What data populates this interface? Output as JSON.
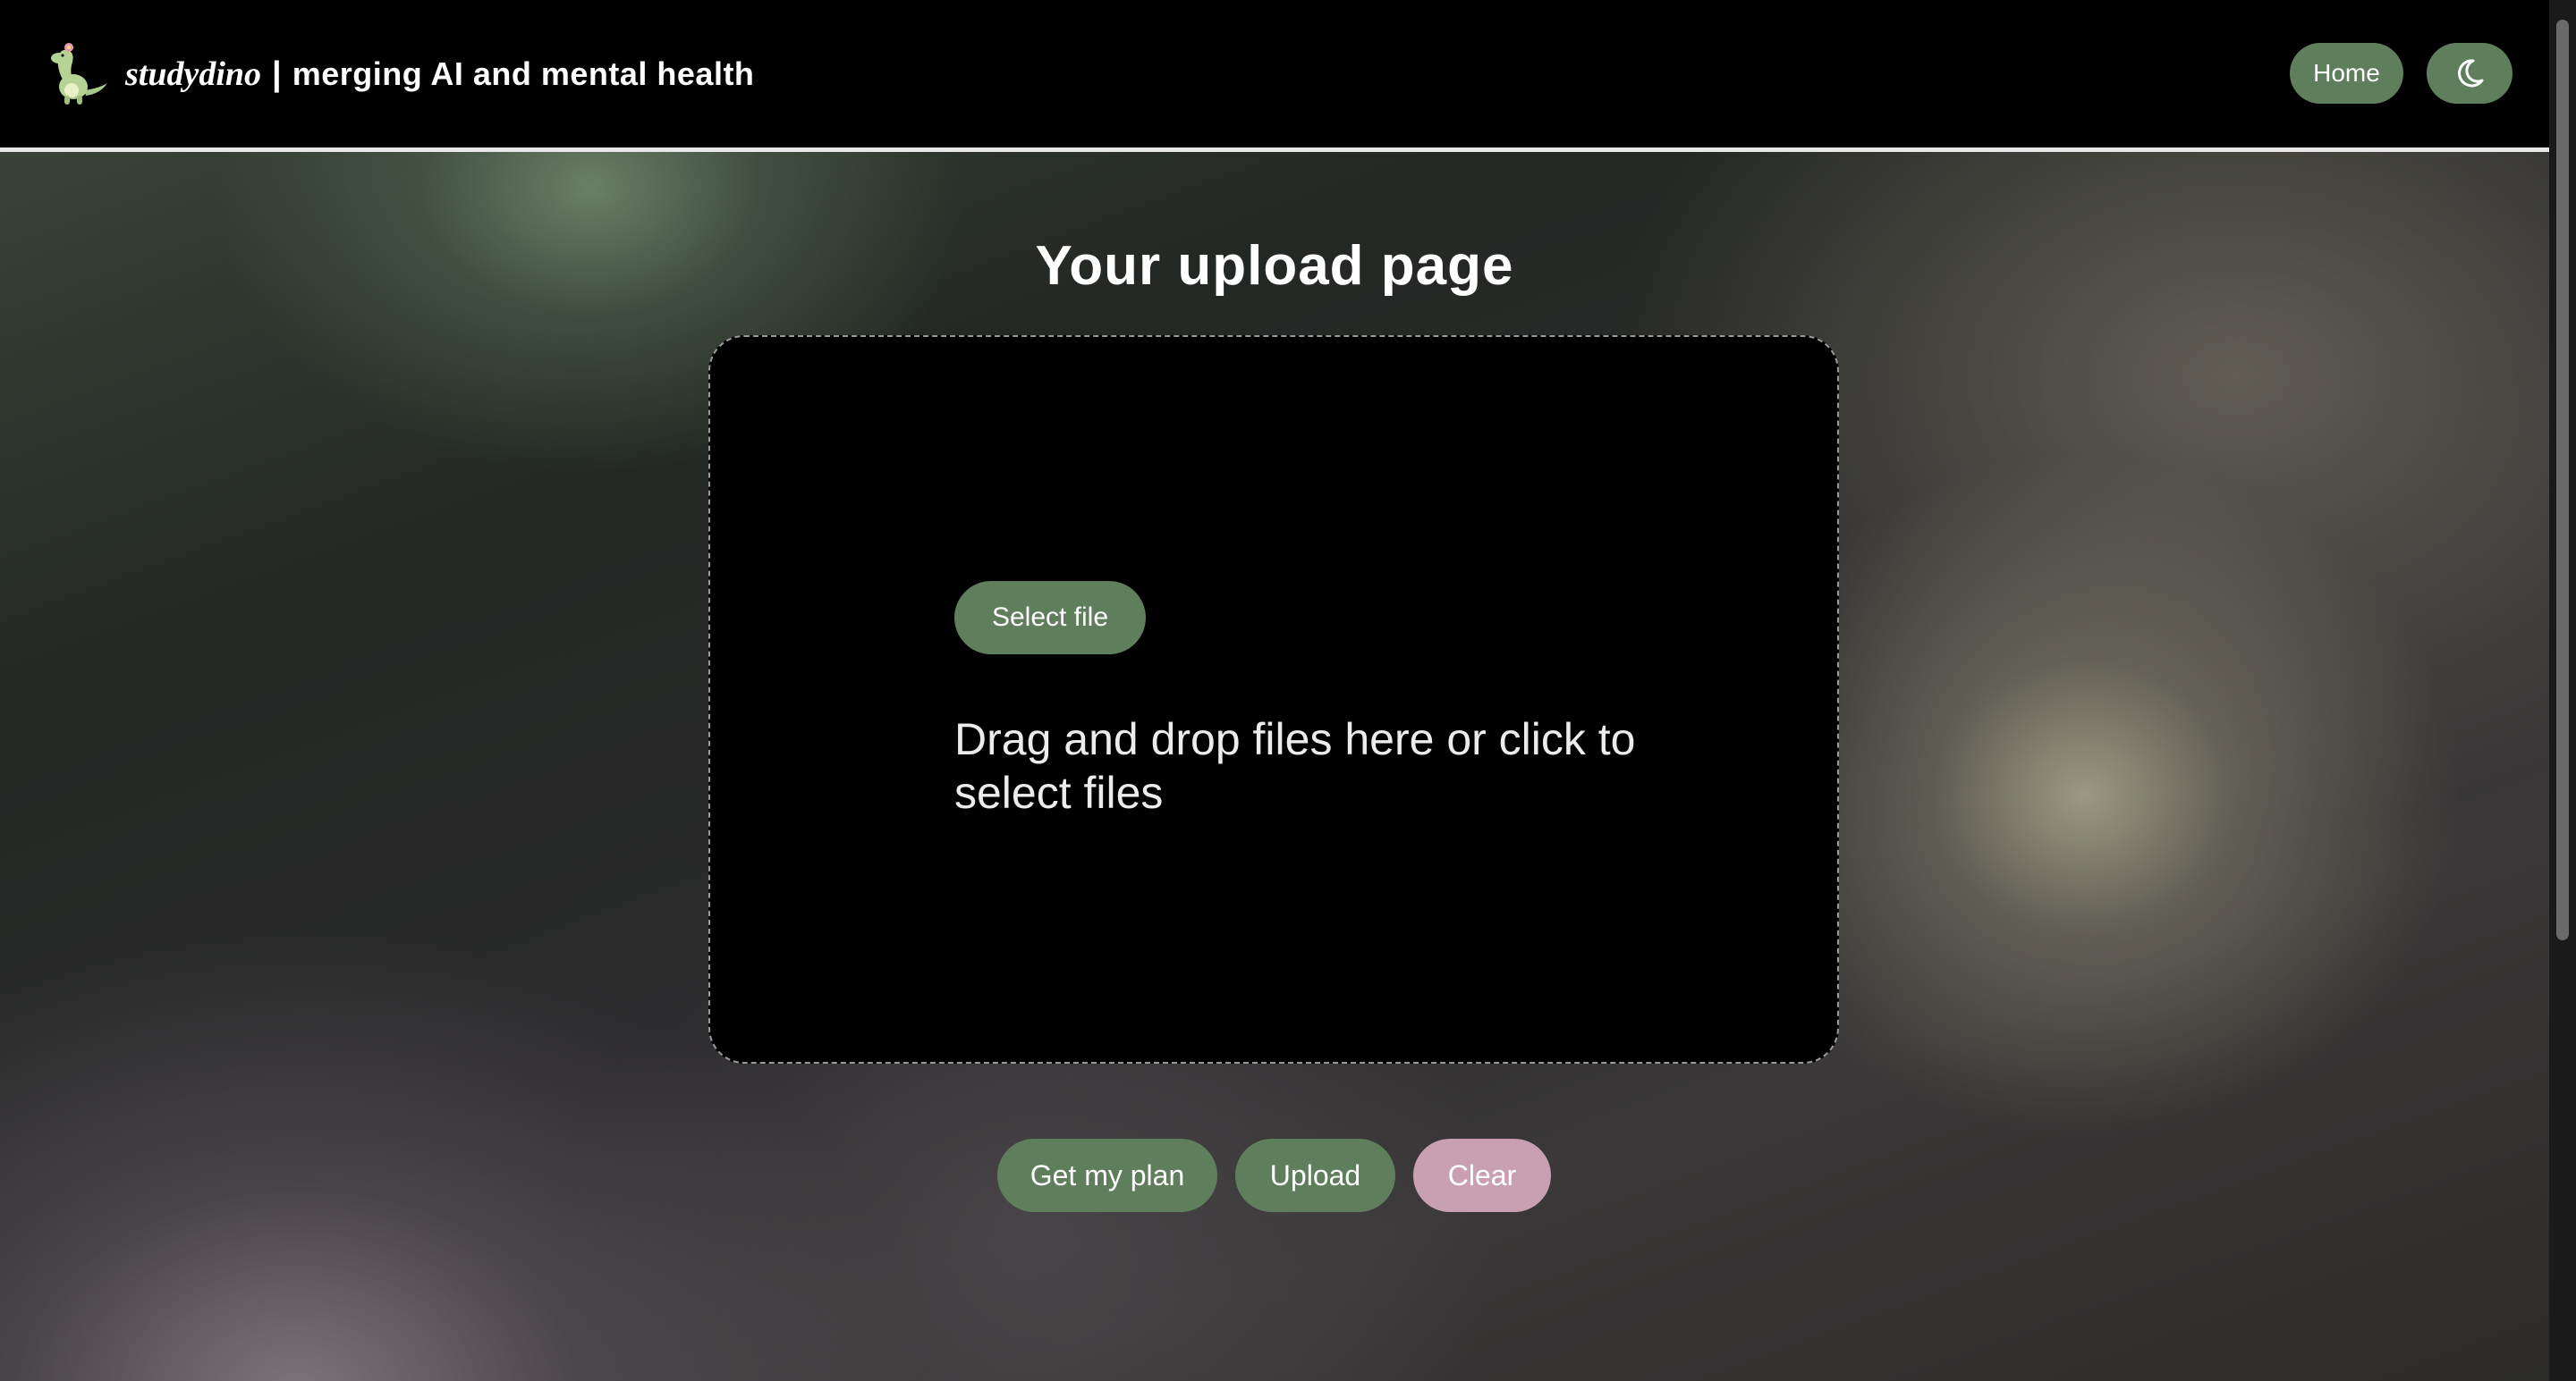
{
  "header": {
    "brand_name": "studydino",
    "separator": "|",
    "tagline": "merging AI and mental health",
    "logo_icon": "dino-logo-icon",
    "home_label": "Home",
    "theme_icon": "moon-icon"
  },
  "main": {
    "title": "Your upload page",
    "dropzone": {
      "select_label": "Select file",
      "hint": "Drag and drop files here or click to select files"
    },
    "actions": {
      "plan_label": "Get my plan",
      "upload_label": "Upload",
      "clear_label": "Clear"
    }
  },
  "colors": {
    "accent_green": "#5f7f5c",
    "clear_pink": "#c9a0b2",
    "header_bg": "#000000"
  }
}
